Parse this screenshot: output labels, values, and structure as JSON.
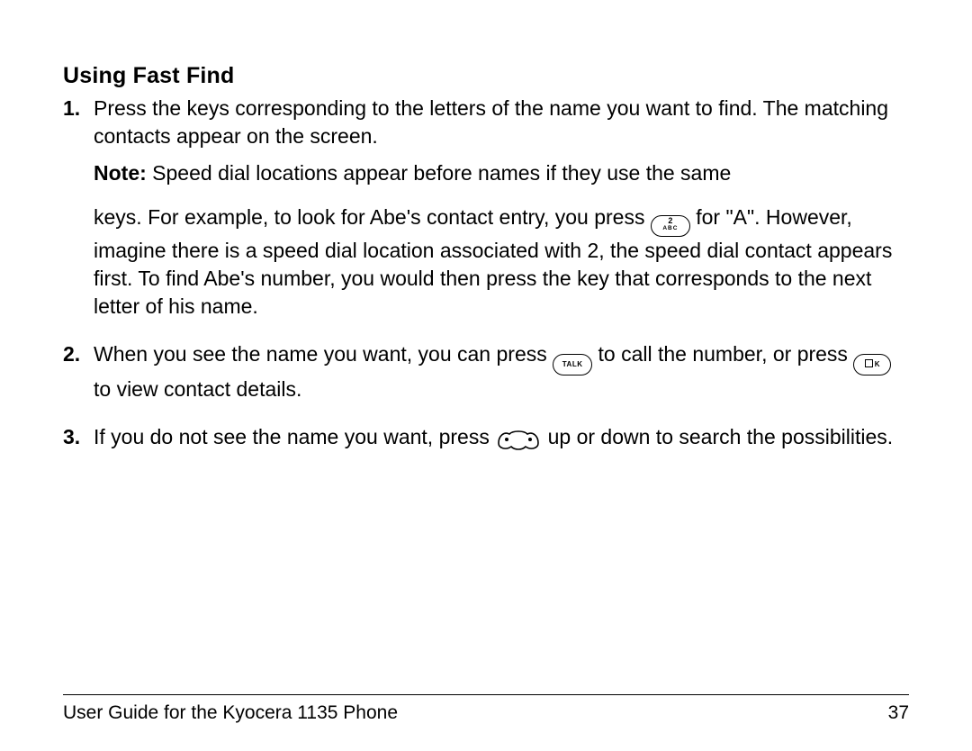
{
  "heading": "Using Fast Find",
  "step1": {
    "text": "Press the keys corresponding to the letters of the name you want to find. The matching contacts appear on the screen.",
    "note_label": "Note:",
    "note_part1": "Speed dial locations appear before names if they use the same",
    "note_part2a": "keys. For example, to look for Abe's contact entry, you press ",
    "key2_top": "2",
    "key2_bot": "ABC",
    "note_part2b": " for \"A\". However, imagine there is a speed dial location associated with 2, the speed dial contact appears first. To find Abe's number, you would then press the key that corresponds to the next letter of his name."
  },
  "step2": {
    "a": "When you see the name you want, you can press ",
    "talk": "TALK",
    "b": " to call the number, or press ",
    "ok": "K",
    "c": " to view contact details."
  },
  "step3": {
    "a": "If you do not see the name you want, press ",
    "b": " up or down to search the possibilities."
  },
  "footer": {
    "title": "User Guide for the Kyocera 1135 Phone",
    "page": "37"
  }
}
